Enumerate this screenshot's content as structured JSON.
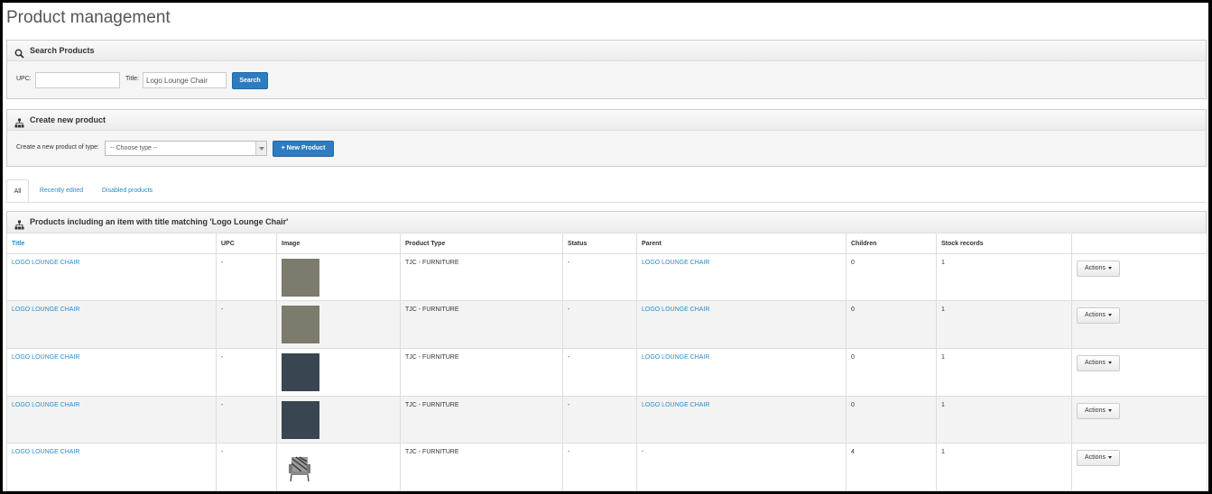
{
  "page": {
    "title": "Product management"
  },
  "search": {
    "heading": "Search Products",
    "upc_label": "UPC:",
    "upc_value": "",
    "title_label": "Title:",
    "title_value": "Logo Lounge Chair",
    "button": "Search"
  },
  "create": {
    "heading": "Create new product",
    "type_label": "Create a new product of type:",
    "type_selected": "-- Choose type --",
    "button": "+ New Product"
  },
  "tabs": [
    "All",
    "Recently edited",
    "Disabled products"
  ],
  "results": {
    "heading": "Products including an item with title matching 'Logo Lounge Chair'",
    "columns": [
      "Title",
      "UPC",
      "Image",
      "Product Type",
      "Status",
      "Parent",
      "Children",
      "Stock records",
      ""
    ],
    "action_label": "Actions",
    "rows": [
      {
        "title": "LOGO LOUNGE CHAIR",
        "upc": "-",
        "image": "gray-fabric-swatch",
        "image_color": "#7d7a6e",
        "product_type": "TJC - FURNITURE",
        "status": "-",
        "parent": "LOGO LOUNGE CHAIR",
        "children": "0",
        "stock_records": "1"
      },
      {
        "title": "LOGO LOUNGE CHAIR",
        "upc": "-",
        "image": "gray-fabric-swatch",
        "image_color": "#7d7a6e",
        "product_type": "TJC - FURNITURE",
        "status": "-",
        "parent": "LOGO LOUNGE CHAIR",
        "children": "0",
        "stock_records": "1"
      },
      {
        "title": "LOGO LOUNGE CHAIR",
        "upc": "-",
        "image": "slate-fabric-swatch",
        "image_color": "#3a4552",
        "product_type": "TJC - FURNITURE",
        "status": "-",
        "parent": "LOGO LOUNGE CHAIR",
        "children": "0",
        "stock_records": "1"
      },
      {
        "title": "LOGO LOUNGE CHAIR",
        "upc": "-",
        "image": "slate-fabric-swatch",
        "image_color": "#3a4552",
        "product_type": "TJC - FURNITURE",
        "status": "-",
        "parent": "LOGO LOUNGE CHAIR",
        "children": "0",
        "stock_records": "1"
      },
      {
        "title": "LOGO LOUNGE CHAIR",
        "upc": "-",
        "image": "lounge-chair-photo",
        "image_color": "#ffffff",
        "product_type": "TJC - FURNITURE",
        "status": "-",
        "parent": "-",
        "children": "4",
        "stock_records": "1"
      }
    ]
  },
  "colors": {
    "link": "#2a8cc7",
    "primary_button": "#2e7cbf"
  }
}
